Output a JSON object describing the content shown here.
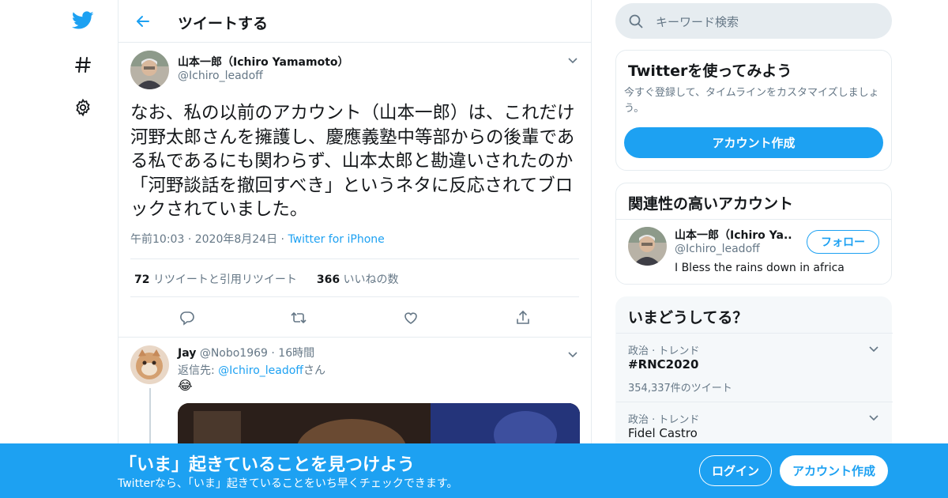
{
  "colors": {
    "accent": "#1da1f2",
    "text": "#14171a",
    "muted": "#657786",
    "border": "#e6ecf0"
  },
  "nav": {
    "icons": [
      "twitter-bird-icon",
      "hashtag-icon",
      "gear-icon"
    ]
  },
  "header": {
    "title": "ツイートする",
    "back_icon": "back-arrow-icon"
  },
  "tweet": {
    "author_name": "山本一郎（Ichiro Yamamoto）",
    "author_handle": "@Ichiro_leadoff",
    "text": "なお、私の以前のアカウント（山本一郎）は、これだけ河野太郎さんを擁護し、慶應義塾中等部からの後輩である私であるにも関わらず、山本太郎と勘違いされたのか「河野談話を撤回すべき」というネタに反応されてブロックされていました。",
    "time": "午前10:03",
    "date": "2020年8月24日",
    "source": "Twitter for iPhone",
    "retweets_count": "72",
    "retweets_label": "リツイートと引用リツイート",
    "likes_count": "366",
    "likes_label": "いいねの数",
    "actions": [
      "reply-icon",
      "retweet-icon",
      "like-icon",
      "share-icon"
    ]
  },
  "reply": {
    "name": "Jay",
    "handle": "@Nobo1969",
    "time": "16時間",
    "reply_prefix": "返信先: ",
    "reply_to": "@Ichiro_leadoff",
    "reply_suffix": "さん",
    "emoji": "😂"
  },
  "search": {
    "placeholder": "キーワード検索"
  },
  "signup_card": {
    "title": "Twitterを使ってみよう",
    "desc": "今すぐ登録して、タイムラインをカスタマイズしましょう。",
    "button": "アカウント作成"
  },
  "related": {
    "title": "関連性の高いアカウント",
    "name": "山本一郎（Ichiro Ya...",
    "handle": "@Ichiro_leadoff",
    "bio": "I Bless the rains down in africa",
    "follow_button": "フォロー"
  },
  "trends": {
    "title": "いまどうしてる？",
    "items": [
      {
        "category": "政治 · トレンド",
        "name": "#RNC2020",
        "count": "354,337件のツイート"
      },
      {
        "category": "政治 · トレンド",
        "name": "Fidel Castro",
        "count": ""
      }
    ]
  },
  "banner": {
    "title": "「いま」起きていることを見つけよう",
    "subtitle": "Twitterなら、「いま」起きていることをいち早くチェックできます。",
    "login": "ログイン",
    "signup": "アカウント作成"
  }
}
